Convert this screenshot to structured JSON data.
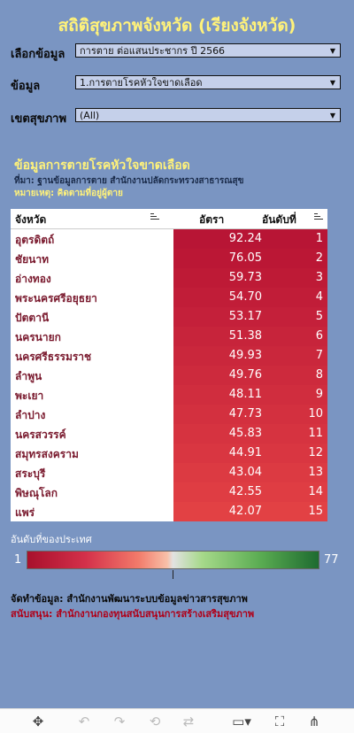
{
  "title": "สถิติสุขภาพจังหวัด (เรียงจังหวัด)",
  "filters": [
    {
      "label": "เลือกข้อมูล",
      "value": "การตาย ต่อแสนประชากร ปี 2566"
    },
    {
      "label": "ข้อมูล",
      "value": "1.การตายโรคหัวใจขาดเลือด"
    },
    {
      "label": "เขตสุขภาพ",
      "value": "(All)"
    }
  ],
  "section": {
    "title": "ข้อมูลการตายโรคหัวใจขาดเลือด",
    "source": "ที่มา: ฐานข้อมูลการตาย สำนักงานปลัดกระทรวงสาธารณสุข",
    "note": "หมายเหตุ: คิดตามที่อยู่ผู้ตาย"
  },
  "table": {
    "headers": {
      "province": "จังหวัด",
      "rate": "อัตรา",
      "rank": "อันดับที่"
    },
    "rows": [
      {
        "province": "อุตรดิตถ์",
        "rate": "92.24",
        "rank": "1",
        "color": "#b81535"
      },
      {
        "province": "ชัยนาท",
        "rate": "76.05",
        "rank": "2",
        "color": "#bb1735"
      },
      {
        "province": "อ่างทอง",
        "rate": "59.73",
        "rank": "3",
        "color": "#be1a36"
      },
      {
        "province": "พระนครศรีอยุธยา",
        "rate": "54.70",
        "rank": "4",
        "color": "#c11d38"
      },
      {
        "province": "ปัตตานี",
        "rate": "53.17",
        "rank": "5",
        "color": "#c4203a"
      },
      {
        "province": "นครนายก",
        "rate": "51.38",
        "rank": "6",
        "color": "#c7243b"
      },
      {
        "province": "นครศรีธรรมราช",
        "rate": "49.93",
        "rank": "7",
        "color": "#ca273c"
      },
      {
        "province": "ลำพูน",
        "rate": "49.76",
        "rank": "8",
        "color": "#cd2a3d"
      },
      {
        "province": "พะเยา",
        "rate": "48.11",
        "rank": "9",
        "color": "#d02d3e"
      },
      {
        "province": "ลำปาง",
        "rate": "47.73",
        "rank": "10",
        "color": "#d3303f"
      },
      {
        "province": "นครสวรรค์",
        "rate": "45.83",
        "rank": "11",
        "color": "#d63340"
      },
      {
        "province": "สมุทรสงคราม",
        "rate": "44.91",
        "rank": "12",
        "color": "#d93641"
      },
      {
        "province": "สระบุรี",
        "rate": "43.04",
        "rank": "13",
        "color": "#dc3a42"
      },
      {
        "province": "พิษณุโลก",
        "rate": "42.55",
        "rank": "14",
        "color": "#df3d43"
      },
      {
        "province": "แพร่",
        "rate": "42.07",
        "rank": "15",
        "color": "#e24144"
      }
    ]
  },
  "legend": {
    "label": "อันดับที่ของประเทศ",
    "min": "1",
    "max": "77"
  },
  "credits": {
    "line1": "จัดทำข้อมูล: สำนักงานพัฒนาระบบข้อมูลข่าวสารสุขภาพ",
    "line2": "สนับสนุน: สำนักงานกองทุนสนับสนุนการสร้างเสริมสุขภาพ"
  },
  "toolbar": {
    "icons": [
      "move-icon",
      "undo-icon",
      "redo-icon",
      "revert-icon",
      "refresh-icon",
      "download-icon",
      "fullscreen-icon",
      "share-icon"
    ]
  }
}
